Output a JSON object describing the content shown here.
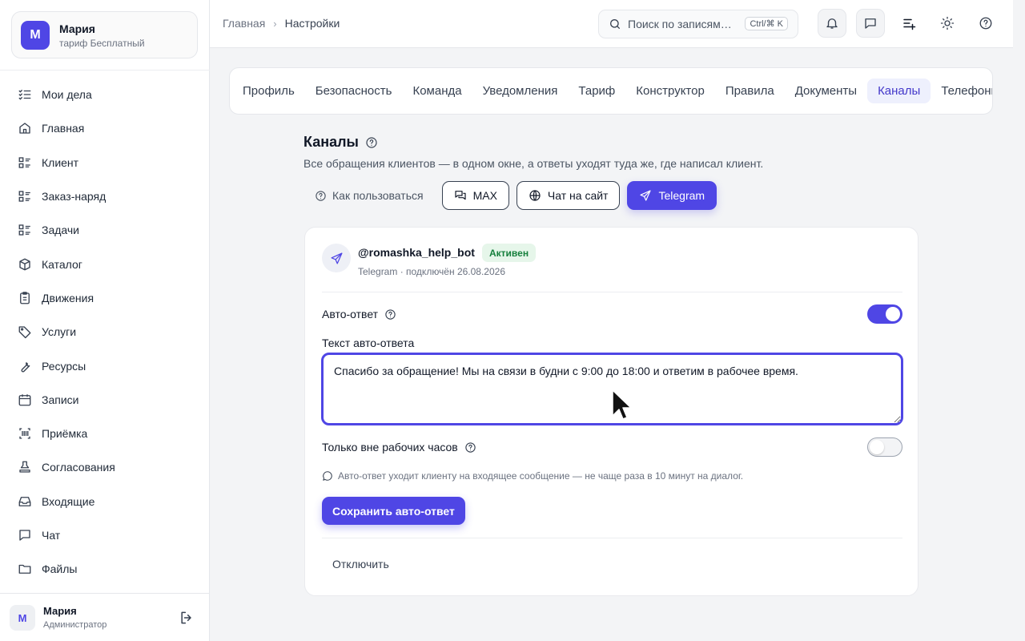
{
  "account": {
    "initial": "М",
    "name": "Мария",
    "plan": "тариф Бесплатный"
  },
  "nav": [
    {
      "label": "Мои дела",
      "icon": "checklist-icon"
    },
    {
      "label": "Главная",
      "icon": "home-icon"
    },
    {
      "label": "Клиент",
      "icon": "list-icon"
    },
    {
      "label": "Заказ-наряд",
      "icon": "list-icon"
    },
    {
      "label": "Задачи",
      "icon": "list-icon"
    },
    {
      "label": "Каталог",
      "icon": "box-icon"
    },
    {
      "label": "Движения",
      "icon": "clipboard-icon"
    },
    {
      "label": "Услуги",
      "icon": "tag-icon"
    },
    {
      "label": "Ресурсы",
      "icon": "wrench-icon"
    },
    {
      "label": "Записи",
      "icon": "calendar-icon"
    },
    {
      "label": "Приёмка",
      "icon": "barcode-icon"
    },
    {
      "label": "Согласования",
      "icon": "stamp-icon"
    },
    {
      "label": "Входящие",
      "icon": "inbox-icon"
    },
    {
      "label": "Чат",
      "icon": "chat-icon"
    },
    {
      "label": "Файлы",
      "icon": "folder-icon"
    }
  ],
  "user": {
    "initial": "М",
    "name": "Мария",
    "role": "Администратор"
  },
  "breadcrumb": {
    "home": "Главная",
    "current": "Настройки",
    "separator": "›"
  },
  "search": {
    "placeholder": "Поиск по записям…",
    "shortcut": "Ctrl/⌘ K"
  },
  "tabs": [
    "Профиль",
    "Безопасность",
    "Команда",
    "Уведомления",
    "Тариф",
    "Конструктор",
    "Правила",
    "Документы",
    "Каналы",
    "Телефония"
  ],
  "active_tab": "Каналы",
  "page": {
    "title": "Каналы",
    "subtitle": "Все обращения клиентов — в одном окне, а ответы уходят туда же, где написал клиент.",
    "how_to": "Как пользоваться",
    "channels": [
      "MAX",
      "Чат на сайт",
      "Telegram"
    ],
    "active_channel": "Telegram"
  },
  "bot": {
    "name": "@romashka_help_bot",
    "status": "Активен",
    "meta": "Telegram · подключён 26.08.2026"
  },
  "auto_reply": {
    "label": "Авто-ответ",
    "enabled": true,
    "text_label": "Текст авто-ответа",
    "text": "Спасибо за обращение! Мы на связи в будни с 9:00 до 18:00 и ответим в рабочее время.",
    "off_hours_label": "Только вне рабочих часов",
    "off_hours_enabled": false,
    "hint": "Авто-ответ уходит клиенту на входящее сообщение — не чаще раза в 10 минут на диалог.",
    "save_label": "Сохранить авто-ответ",
    "disable_label": "Отключить"
  },
  "colors": {
    "accent": "#4f46e5",
    "status_active_bg": "#e6f6ea",
    "status_active_text": "#16803d"
  }
}
